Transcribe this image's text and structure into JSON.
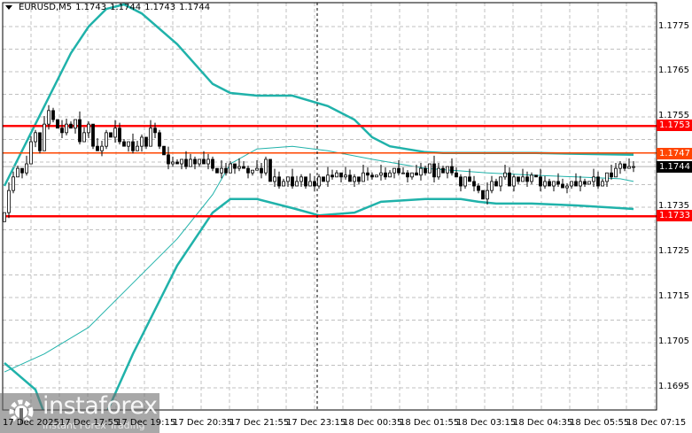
{
  "header": {
    "symbol": "EURUSD,M5",
    "open": "1.1743",
    "high": "1.1744",
    "low": "1.1743",
    "close": "1.1744"
  },
  "price_axis": [
    "1.1775",
    "1.1765",
    "1.1755",
    "1.1735",
    "1.1725",
    "1.1715",
    "1.1705",
    "1.1695"
  ],
  "levels": [
    {
      "label": "1.1753",
      "price": 1.1753,
      "color": "#ff0000"
    },
    {
      "label": "1.1747",
      "price": 1.1747,
      "color": "#ff4500"
    },
    {
      "label": "1.1733",
      "price": 1.1733,
      "color": "#ff0000"
    }
  ],
  "bid": {
    "label": "1.1744",
    "price": 1.1744
  },
  "time_axis": [
    "17 Dec 2025",
    "17 Dec 17:55",
    "17 Dec 19:15",
    "17 Dec 20:35",
    "17 Dec 21:55",
    "17 Dec 23:15",
    "18 Dec 00:35",
    "18 Dec 01:55",
    "18 Dec 03:15",
    "18 Dec 04:35",
    "18 Dec 05:55",
    "18 Dec 07:15"
  ],
  "logo": {
    "name": "instaforex",
    "tagline": "Instant Forex Trading"
  },
  "colors": {
    "band": "#20b2aa",
    "bull": "#ffffff",
    "bear": "#000000"
  },
  "closes": [
    1.17338,
    1.17387,
    1.17417,
    1.17436,
    1.17426,
    1.17446,
    1.17495,
    1.17515,
    1.17475,
    1.17534,
    1.17564,
    1.17544,
    1.17525,
    1.17515,
    1.17534,
    1.17525,
    1.17544,
    1.17495,
    1.17515,
    1.17534,
    1.17485,
    1.17475,
    1.17485,
    1.17515,
    1.17505,
    1.17525,
    1.17495,
    1.17485,
    1.17495,
    1.17475,
    1.17485,
    1.17505,
    1.17485,
    1.17525,
    1.17515,
    1.17485,
    1.17466,
    1.17446,
    1.1745,
    1.17446,
    1.17456,
    1.1744,
    1.17456,
    1.17446,
    1.17456,
    1.17446,
    1.17456,
    1.17436,
    1.17426,
    1.17436,
    1.17426,
    1.17446,
    1.17436,
    1.1744,
    1.17436,
    1.17426,
    1.17432,
    1.17436,
    1.17426,
    1.17456,
    1.17407,
    1.17417,
    1.17397,
    1.17407,
    1.17417,
    1.17397,
    1.17407,
    1.17417,
    1.17397,
    1.17407,
    1.17397,
    1.17417,
    1.17407,
    1.17421,
    1.17417,
    1.17426,
    1.17417,
    1.17421,
    1.17407,
    1.17417,
    1.17407,
    1.17426,
    1.17421,
    1.17417,
    1.17421,
    1.17426,
    1.17417,
    1.17426,
    1.17436,
    1.17426,
    1.17426,
    1.17417,
    1.17426,
    1.17421,
    1.17436,
    1.17426,
    1.17446,
    1.17417,
    1.17436,
    1.17426,
    1.1744,
    1.17426,
    1.17417,
    1.17397,
    1.17417,
    1.17407,
    1.17397,
    1.17387,
    1.17368,
    1.17387,
    1.17407,
    1.17397,
    1.17417,
    1.17426,
    1.17397,
    1.17417,
    1.17407,
    1.17417,
    1.17407,
    1.17421,
    1.17417,
    1.17397,
    1.17407,
    1.17397,
    1.17407,
    1.17401,
    1.17393,
    1.17397,
    1.17407,
    1.17397,
    1.17407,
    1.17401,
    1.17407,
    1.17417,
    1.17397,
    1.17407,
    1.17426,
    1.17417,
    1.17436,
    1.17446,
    1.17436,
    1.1744,
    1.1744
  ],
  "bands": {
    "upper": [
      [
        0,
        1.17397
      ],
      [
        5,
        1.17495
      ],
      [
        10,
        1.17593
      ],
      [
        15,
        1.17691
      ],
      [
        19,
        1.1775
      ],
      [
        23,
        1.17789
      ],
      [
        27,
        1.17799
      ],
      [
        31,
        1.17779
      ],
      [
        39,
        1.17711
      ],
      [
        47,
        1.17623
      ],
      [
        51,
        1.17603
      ],
      [
        57,
        1.17597
      ],
      [
        65,
        1.17597
      ],
      [
        73,
        1.17574
      ],
      [
        79,
        1.17544
      ],
      [
        83,
        1.17505
      ],
      [
        87,
        1.17485
      ],
      [
        95,
        1.17472
      ],
      [
        99,
        1.1747
      ],
      [
        120,
        1.1747
      ],
      [
        130,
        1.17468
      ],
      [
        142,
        1.17466
      ]
    ],
    "middle": [
      [
        0,
        1.16985
      ],
      [
        9,
        1.17025
      ],
      [
        19,
        1.17084
      ],
      [
        29,
        1.17182
      ],
      [
        39,
        1.1728
      ],
      [
        47,
        1.17378
      ],
      [
        51,
        1.17446
      ],
      [
        57,
        1.17479
      ],
      [
        65,
        1.17485
      ],
      [
        73,
        1.17475
      ],
      [
        83,
        1.17456
      ],
      [
        95,
        1.17436
      ],
      [
        109,
        1.17426
      ],
      [
        119,
        1.17421
      ],
      [
        129,
        1.17417
      ],
      [
        139,
        1.17413
      ],
      [
        142,
        1.17407
      ]
    ],
    "lower": [
      [
        0,
        1.17005
      ],
      [
        7,
        1.16946
      ],
      [
        13,
        1.16789
      ],
      [
        17,
        1.16711
      ],
      [
        21,
        1.1685
      ],
      [
        29,
        1.17025
      ],
      [
        39,
        1.17221
      ],
      [
        47,
        1.17338
      ],
      [
        51,
        1.17368
      ],
      [
        57,
        1.17368
      ],
      [
        65,
        1.17348
      ],
      [
        71,
        1.17332
      ],
      [
        79,
        1.17338
      ],
      [
        85,
        1.17362
      ],
      [
        95,
        1.17368
      ],
      [
        103,
        1.17368
      ],
      [
        107,
        1.17362
      ],
      [
        111,
        1.17358
      ],
      [
        119,
        1.17358
      ],
      [
        129,
        1.17354
      ],
      [
        139,
        1.17348
      ],
      [
        142,
        1.17346
      ]
    ]
  }
}
